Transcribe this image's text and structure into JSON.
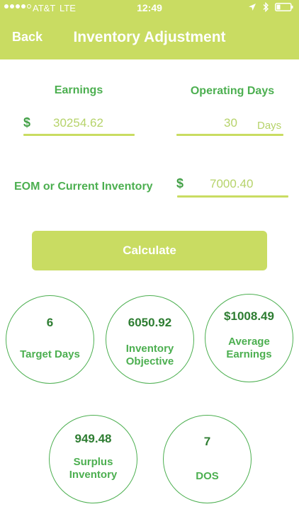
{
  "status_bar": {
    "carrier": "AT&T",
    "network": "LTE",
    "time": "12:49",
    "location_icon": "location-arrow-icon",
    "bluetooth_icon": "bluetooth-icon",
    "battery_icon": "battery-icon"
  },
  "header": {
    "back_label": "Back",
    "title": "Inventory Adjustment",
    "color": "#c9dc62"
  },
  "form": {
    "earnings": {
      "label": "Earnings",
      "currency": "$",
      "value": "30254.62"
    },
    "operating_days": {
      "label": "Operating Days",
      "value": "30",
      "unit": "Days"
    },
    "inventory": {
      "label": "EOM or Current Inventory",
      "currency": "$",
      "value": "7000.40"
    },
    "calculate_label": "Calculate"
  },
  "results": {
    "target_days": {
      "value": "6",
      "label": "Target Days"
    },
    "inventory_objective": {
      "value": "6050.92",
      "label_line1": "Inventory",
      "label_line2": "Objective"
    },
    "average_earnings": {
      "value": "$1008.49",
      "label_line1": "Average",
      "label_line2": "Earnings"
    },
    "surplus_inventory": {
      "value": "949.48",
      "label_line1": "Surplus",
      "label_line2": "Inventory"
    },
    "dos": {
      "value": "7",
      "label": "DOS"
    }
  },
  "colors": {
    "accent": "#c9dc62",
    "green_text": "#4caf50",
    "dark_green": "#2e7d32",
    "input_text": "#b6d36a"
  }
}
